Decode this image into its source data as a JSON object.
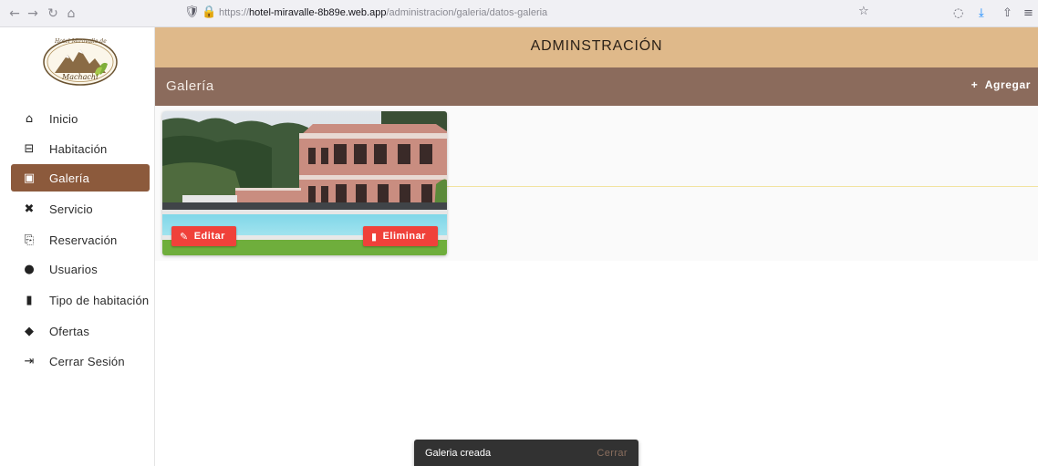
{
  "browser": {
    "back_icon": "←",
    "forward_icon": "→",
    "reload_icon": "↻",
    "home_icon": "⌂",
    "url_prefix": "https://",
    "url_domain": "hotel-miravalle-8b89e.web.app",
    "url_path": "/administracion/galeria/datos-galeria",
    "bookmark_icon": "☆",
    "pocket_icon": "◌",
    "download_icon": "⤓",
    "share_icon": "⇧",
    "menu_icon": "≡"
  },
  "logo": {
    "line1": "Hotel Miravalle de",
    "line2": "Machachi"
  },
  "sidebar": {
    "items": [
      {
        "label": "Inicio",
        "icon": "home-icon",
        "glyph": "⌂"
      },
      {
        "label": "Habitación",
        "icon": "bed-icon",
        "glyph": "⊟"
      },
      {
        "label": "Galería",
        "icon": "gallery-icon",
        "glyph": "▣",
        "active": true
      },
      {
        "label": "Servicio",
        "icon": "tools-icon",
        "glyph": "✖"
      },
      {
        "label": "Reservación",
        "icon": "clipboard-icon",
        "glyph": "⎘"
      },
      {
        "label": "Usuarios",
        "icon": "user-circle-icon",
        "glyph": "●"
      },
      {
        "label": "Tipo de habitación",
        "icon": "door-icon",
        "glyph": "▮"
      },
      {
        "label": "Ofertas",
        "icon": "tag-icon",
        "glyph": "◆"
      },
      {
        "label": "Cerrar Sesión",
        "icon": "logout-icon",
        "glyph": "⇥"
      }
    ]
  },
  "header": {
    "title": "ADMINSTRACIÓN"
  },
  "subheader": {
    "title": "Galería",
    "add_icon": "+",
    "add_label": "Agregar"
  },
  "card": {
    "edit_label": "Editar",
    "delete_label": "Eliminar",
    "edit_icon": "✎",
    "delete_icon": "▮"
  },
  "snackbar": {
    "message": "Galeria creada",
    "action": "Cerrar"
  },
  "colors": {
    "header_bg": "#dfb98a",
    "subheader_bg": "#8b6b5c",
    "active_nav": "#8c5a3c",
    "button_red": "#f0413a"
  }
}
